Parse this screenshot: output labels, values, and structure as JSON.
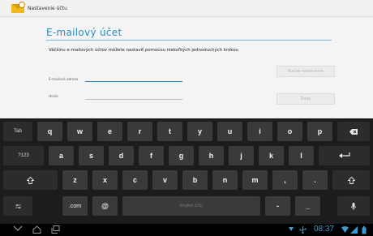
{
  "actionbar": {
    "title": "Nastavenie účtu"
  },
  "page": {
    "title": "E-mailový účet",
    "intro": "Väčšinu e-mailových účtov môžete nastaviť pomocou niekoľkých jednoduchých krokov."
  },
  "form": {
    "email_label": "E-mailová adresa",
    "password_label": "Heslo",
    "manual_button": "Ručné nastavenie",
    "next_button": "Ďalej"
  },
  "keyboard": {
    "row1": [
      "Tab",
      "q",
      "w",
      "e",
      "r",
      "t",
      "y",
      "u",
      "i",
      "o",
      "p"
    ],
    "row2": [
      "?123",
      "a",
      "s",
      "d",
      "f",
      "g",
      "h",
      "j",
      "k",
      "l"
    ],
    "row3": [
      "z",
      "x",
      "c",
      "v",
      "b",
      "n",
      "m",
      ",",
      "."
    ],
    "dotcom": ".com",
    "at": "@",
    "space": "English (US)",
    "dash": "-",
    "underscore": "_"
  },
  "status": {
    "time": "08:37"
  },
  "colors": {
    "accent": "#2b8cc4",
    "keyboard_bg": "#1c1c1e",
    "key_bg": "#3a3a3d"
  }
}
